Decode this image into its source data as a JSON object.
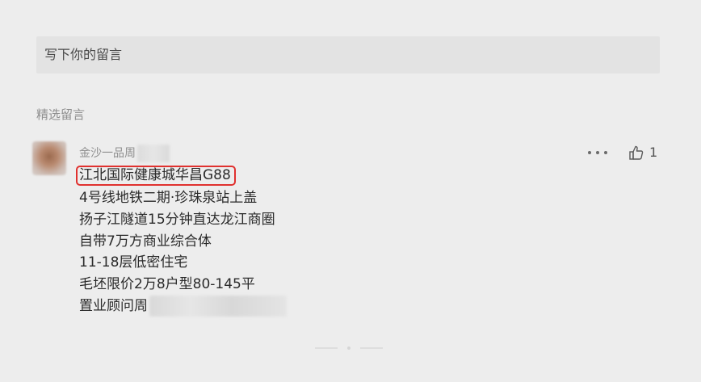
{
  "comment_input": {
    "placeholder": "写下你的留言"
  },
  "section": {
    "title": "精选留言"
  },
  "comment": {
    "author": "金沙一品周",
    "like_count": "1",
    "lines": [
      "江北国际健康城华昌G88",
      "4号线地铁二期·珍珠泉站上盖",
      "扬子江隧道15分钟直达龙江商圈",
      "自带7万方商业综合体",
      "11-18层低密住宅",
      "毛坯限价2万8户型80-145平",
      "置业顾问周"
    ]
  },
  "colors": {
    "background": "#ededed",
    "input_background": "#e3e3e3",
    "highlight_border": "#e0312f",
    "meta_text": "#8f8f8f"
  },
  "icons": {
    "more": "more-dots-icon",
    "like": "thumbs-up-icon"
  }
}
